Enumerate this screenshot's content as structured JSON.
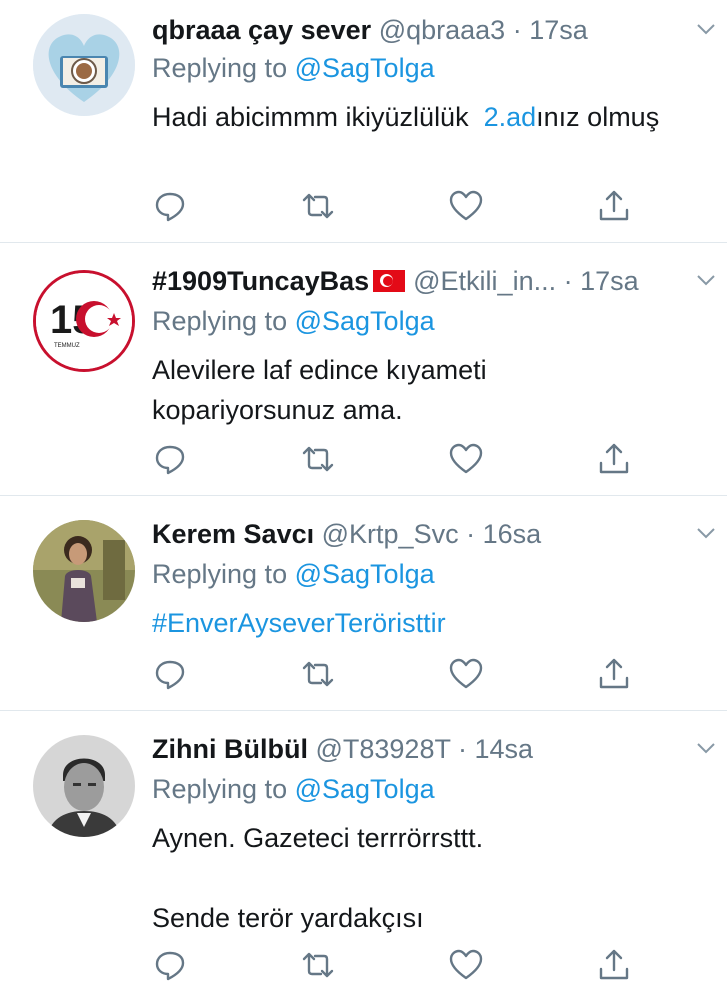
{
  "tweets": [
    {
      "name": "qbraaa çay sever",
      "handle": "@qbraaa3",
      "time": "17sa",
      "reply_prefix": "Replying to",
      "reply_to": "@SagTolga",
      "text_a": "Hadi abicimmm ikiyüzlülük",
      "text_link": "2.ad",
      "text_b": "ınız olmuş"
    },
    {
      "name": "#1909TuncayBas",
      "flag": "🇹🇷",
      "handle": "@Etkili_in...",
      "time": "17sa",
      "reply_prefix": "Replying to",
      "reply_to": "@SagTolga",
      "text": "Alevilere laf edince kıyameti kopariyorsunuz ama.",
      "avatar_text": "15",
      "avatar_small": "TEMMUZ"
    },
    {
      "name": "Kerem Savcı",
      "handle": "@Krtp_Svc",
      "time": "16sa",
      "reply_prefix": "Replying to",
      "reply_to": "@SagTolga",
      "hashtag": "#EnverAyseverTeröristtir"
    },
    {
      "name": "Zihni Bülbül",
      "handle": "@T83928T",
      "time": "14sa",
      "reply_prefix": "Replying to",
      "reply_to": "@SagTolga",
      "text_line1": "Aynen. Gazeteci terrrörrsttt.",
      "text_line2": "Sende terör yardakçısı"
    }
  ],
  "colors": {
    "link": "#1b95e0",
    "secondary": "#657786",
    "primary": "#14171a",
    "divider": "#e1e8ed"
  },
  "icons": [
    "reply-icon",
    "retweet-icon",
    "like-icon",
    "share-icon",
    "chevron-down-icon"
  ]
}
